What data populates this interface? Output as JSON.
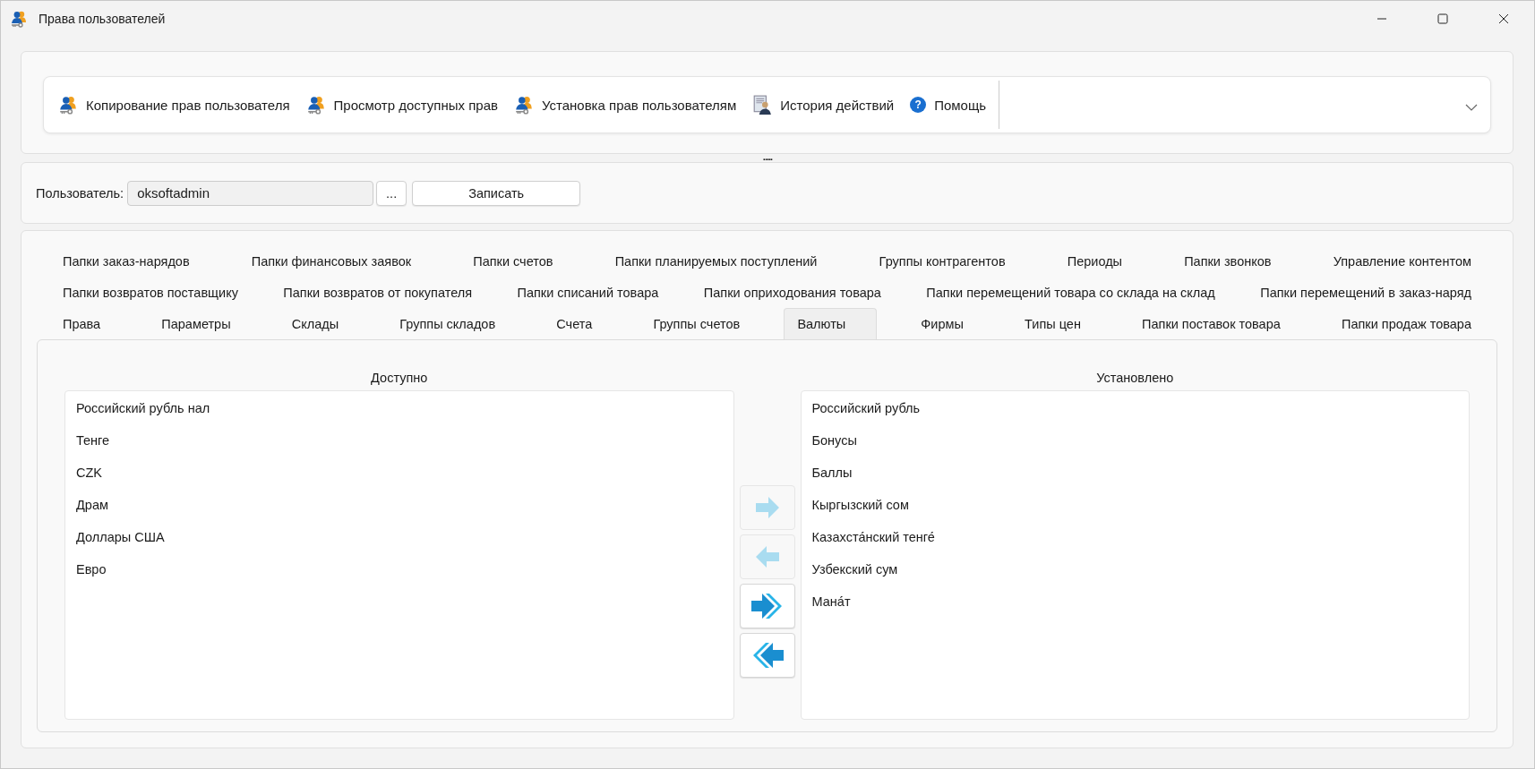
{
  "window": {
    "title": "Права пользователей"
  },
  "toolbar": {
    "items": [
      {
        "label": "Копирование прав пользователя",
        "kind": "users"
      },
      {
        "label": "Просмотр доступных прав",
        "kind": "users"
      },
      {
        "label": "Установка прав пользователям",
        "kind": "users"
      },
      {
        "label": "История действий",
        "kind": "history"
      },
      {
        "label": "Помощь",
        "kind": "help",
        "icon_text": "?"
      }
    ]
  },
  "splitter": {
    "grip": "....."
  },
  "user": {
    "label": "Пользователь:",
    "value": "oksoftadmin",
    "browse_button": "...",
    "save_button": "Записать"
  },
  "tab_rows": [
    [
      {
        "label": "Папки заказ-нарядов",
        "selected": false
      },
      {
        "label": "Папки финансовых заявок",
        "selected": false
      },
      {
        "label": "Папки счетов",
        "selected": false
      },
      {
        "label": "Папки планируемых поступлений",
        "selected": false
      },
      {
        "label": "Группы контрагентов",
        "selected": false
      },
      {
        "label": "Периоды",
        "selected": false
      },
      {
        "label": "Папки звонков",
        "selected": false
      },
      {
        "label": "Управление контентом",
        "selected": false
      }
    ],
    [
      {
        "label": "Папки возвратов поставщику",
        "selected": false
      },
      {
        "label": "Папки возвратов от покупателя",
        "selected": false
      },
      {
        "label": "Папки списаний товара",
        "selected": false
      },
      {
        "label": "Папки оприходования товара",
        "selected": false
      },
      {
        "label": "Папки перемещений товара со склада на склад",
        "selected": false
      },
      {
        "label": "Папки перемещений в заказ-наряд",
        "selected": false
      }
    ],
    [
      {
        "label": "Права",
        "selected": false
      },
      {
        "label": "Параметры",
        "selected": false
      },
      {
        "label": "Склады",
        "selected": false
      },
      {
        "label": "Группы складов",
        "selected": false
      },
      {
        "label": "Счета",
        "selected": false
      },
      {
        "label": "Группы счетов",
        "selected": false
      },
      {
        "label": "Валюты",
        "selected": true
      },
      {
        "label": "Фирмы",
        "selected": false
      },
      {
        "label": "Типы цен",
        "selected": false
      },
      {
        "label": "Папки поставок товара",
        "selected": false
      },
      {
        "label": "Папки продаж товара",
        "selected": false
      }
    ]
  ],
  "available": {
    "title": "Доступно",
    "items": [
      "Российский рубль нал",
      "Тенге",
      "CZK",
      "Драм",
      "Доллары США",
      "Евро"
    ]
  },
  "move_buttons": [
    {
      "kind": "right",
      "disabled": true
    },
    {
      "kind": "left",
      "disabled": true
    },
    {
      "kind": "all_right",
      "disabled": false
    },
    {
      "kind": "all_left",
      "disabled": false
    }
  ],
  "installed": {
    "title": "Установлено",
    "items": [
      "Российский рубль",
      "Бонусы",
      "Баллы",
      "Кыргызский сом",
      "Казахста́нский тенге́",
      "Узбекский сум",
      "Мана́т"
    ]
  }
}
